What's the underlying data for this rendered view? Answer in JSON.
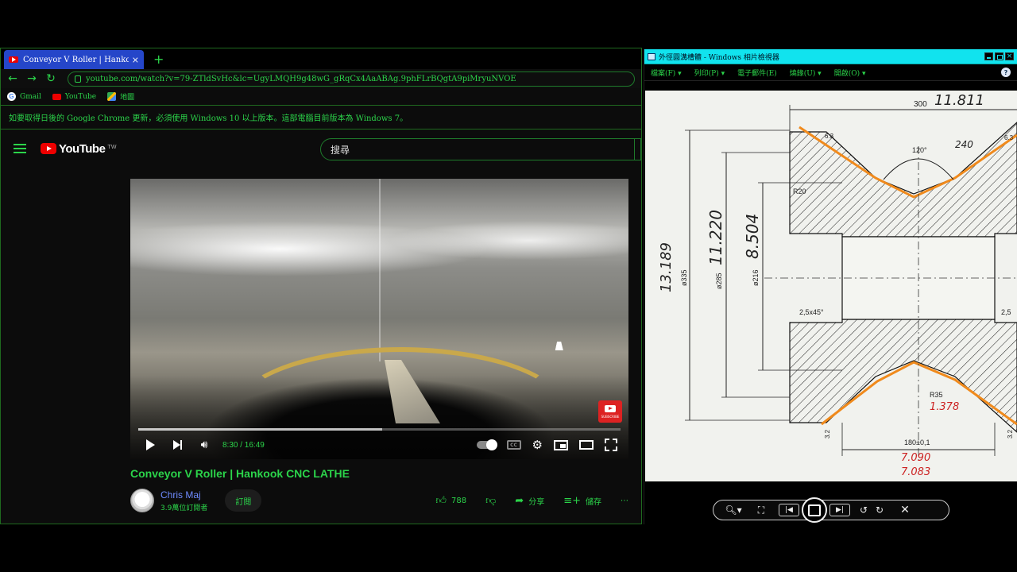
{
  "browser": {
    "tab_title": "Conveyor V Roller | Hankook CNC L",
    "tab_close": "×",
    "new_tab": "+",
    "url": "youtube.com/watch?v=79-ZTldSvHc&lc=UgyLMQH9g48wG_gRqCx4AaABAg.9phFLrBQgtA9piMryuNVOE",
    "bookmarks": [
      {
        "label": "Gmail"
      },
      {
        "label": "YouTube"
      },
      {
        "label": "地圖"
      }
    ],
    "infobar_text": "如要取得日後的 Google Chrome 更新，必須使用 Windows 10 以上版本。這部電腦目前版本為 Windows 7。"
  },
  "youtube": {
    "logo_text": "YouTube",
    "region": "TW",
    "search_placeholder": "搜尋",
    "player": {
      "time": "8:30 / 16:49",
      "progress_fraction": 0.505,
      "watermark_text": "SUBSCRIBE"
    },
    "video_title": "Conveyor V Roller | Hankook CNC LATHE",
    "channel_name": "Chris Maj",
    "subscribers": "3.9萬位訂閱者",
    "subscribe_label": "訂閱",
    "like_count": "788",
    "share_label": "分享",
    "save_label": "儲存",
    "more_label": "⋯"
  },
  "viewer": {
    "title": "外徑圓溝槽體 - Windows 相片檢視器",
    "menu": [
      {
        "label": "檔案(F) ▾"
      },
      {
        "label": "列印(P) ▾"
      },
      {
        "label": "電子郵件(E)"
      },
      {
        "label": "燒錄(U) ▾"
      },
      {
        "label": "開啟(O) ▾"
      }
    ],
    "help": "?",
    "drawing_labels": {
      "top_dim": "300",
      "top_inch": "11.811",
      "chamfer_l": "6.3",
      "chamfer_r": "6.3",
      "angle": "120°",
      "hand_240": "240",
      "r20": "R20",
      "d285": "ø285",
      "d285_inch": "11.220",
      "d216": "ø216",
      "d216_inch": "8.504",
      "d335": "ø335",
      "d335_inch": "13.189",
      "chamfer_left": "2,5x45°",
      "chamfer_right": "2,5",
      "r35": "R35",
      "r35_inch": "1.378",
      "bottom_dim": "180±0,1",
      "bottom_inch_1": "7.090",
      "bottom_inch_2": "7.083",
      "rough_l": "3.2",
      "rough_r": "3.2"
    }
  }
}
